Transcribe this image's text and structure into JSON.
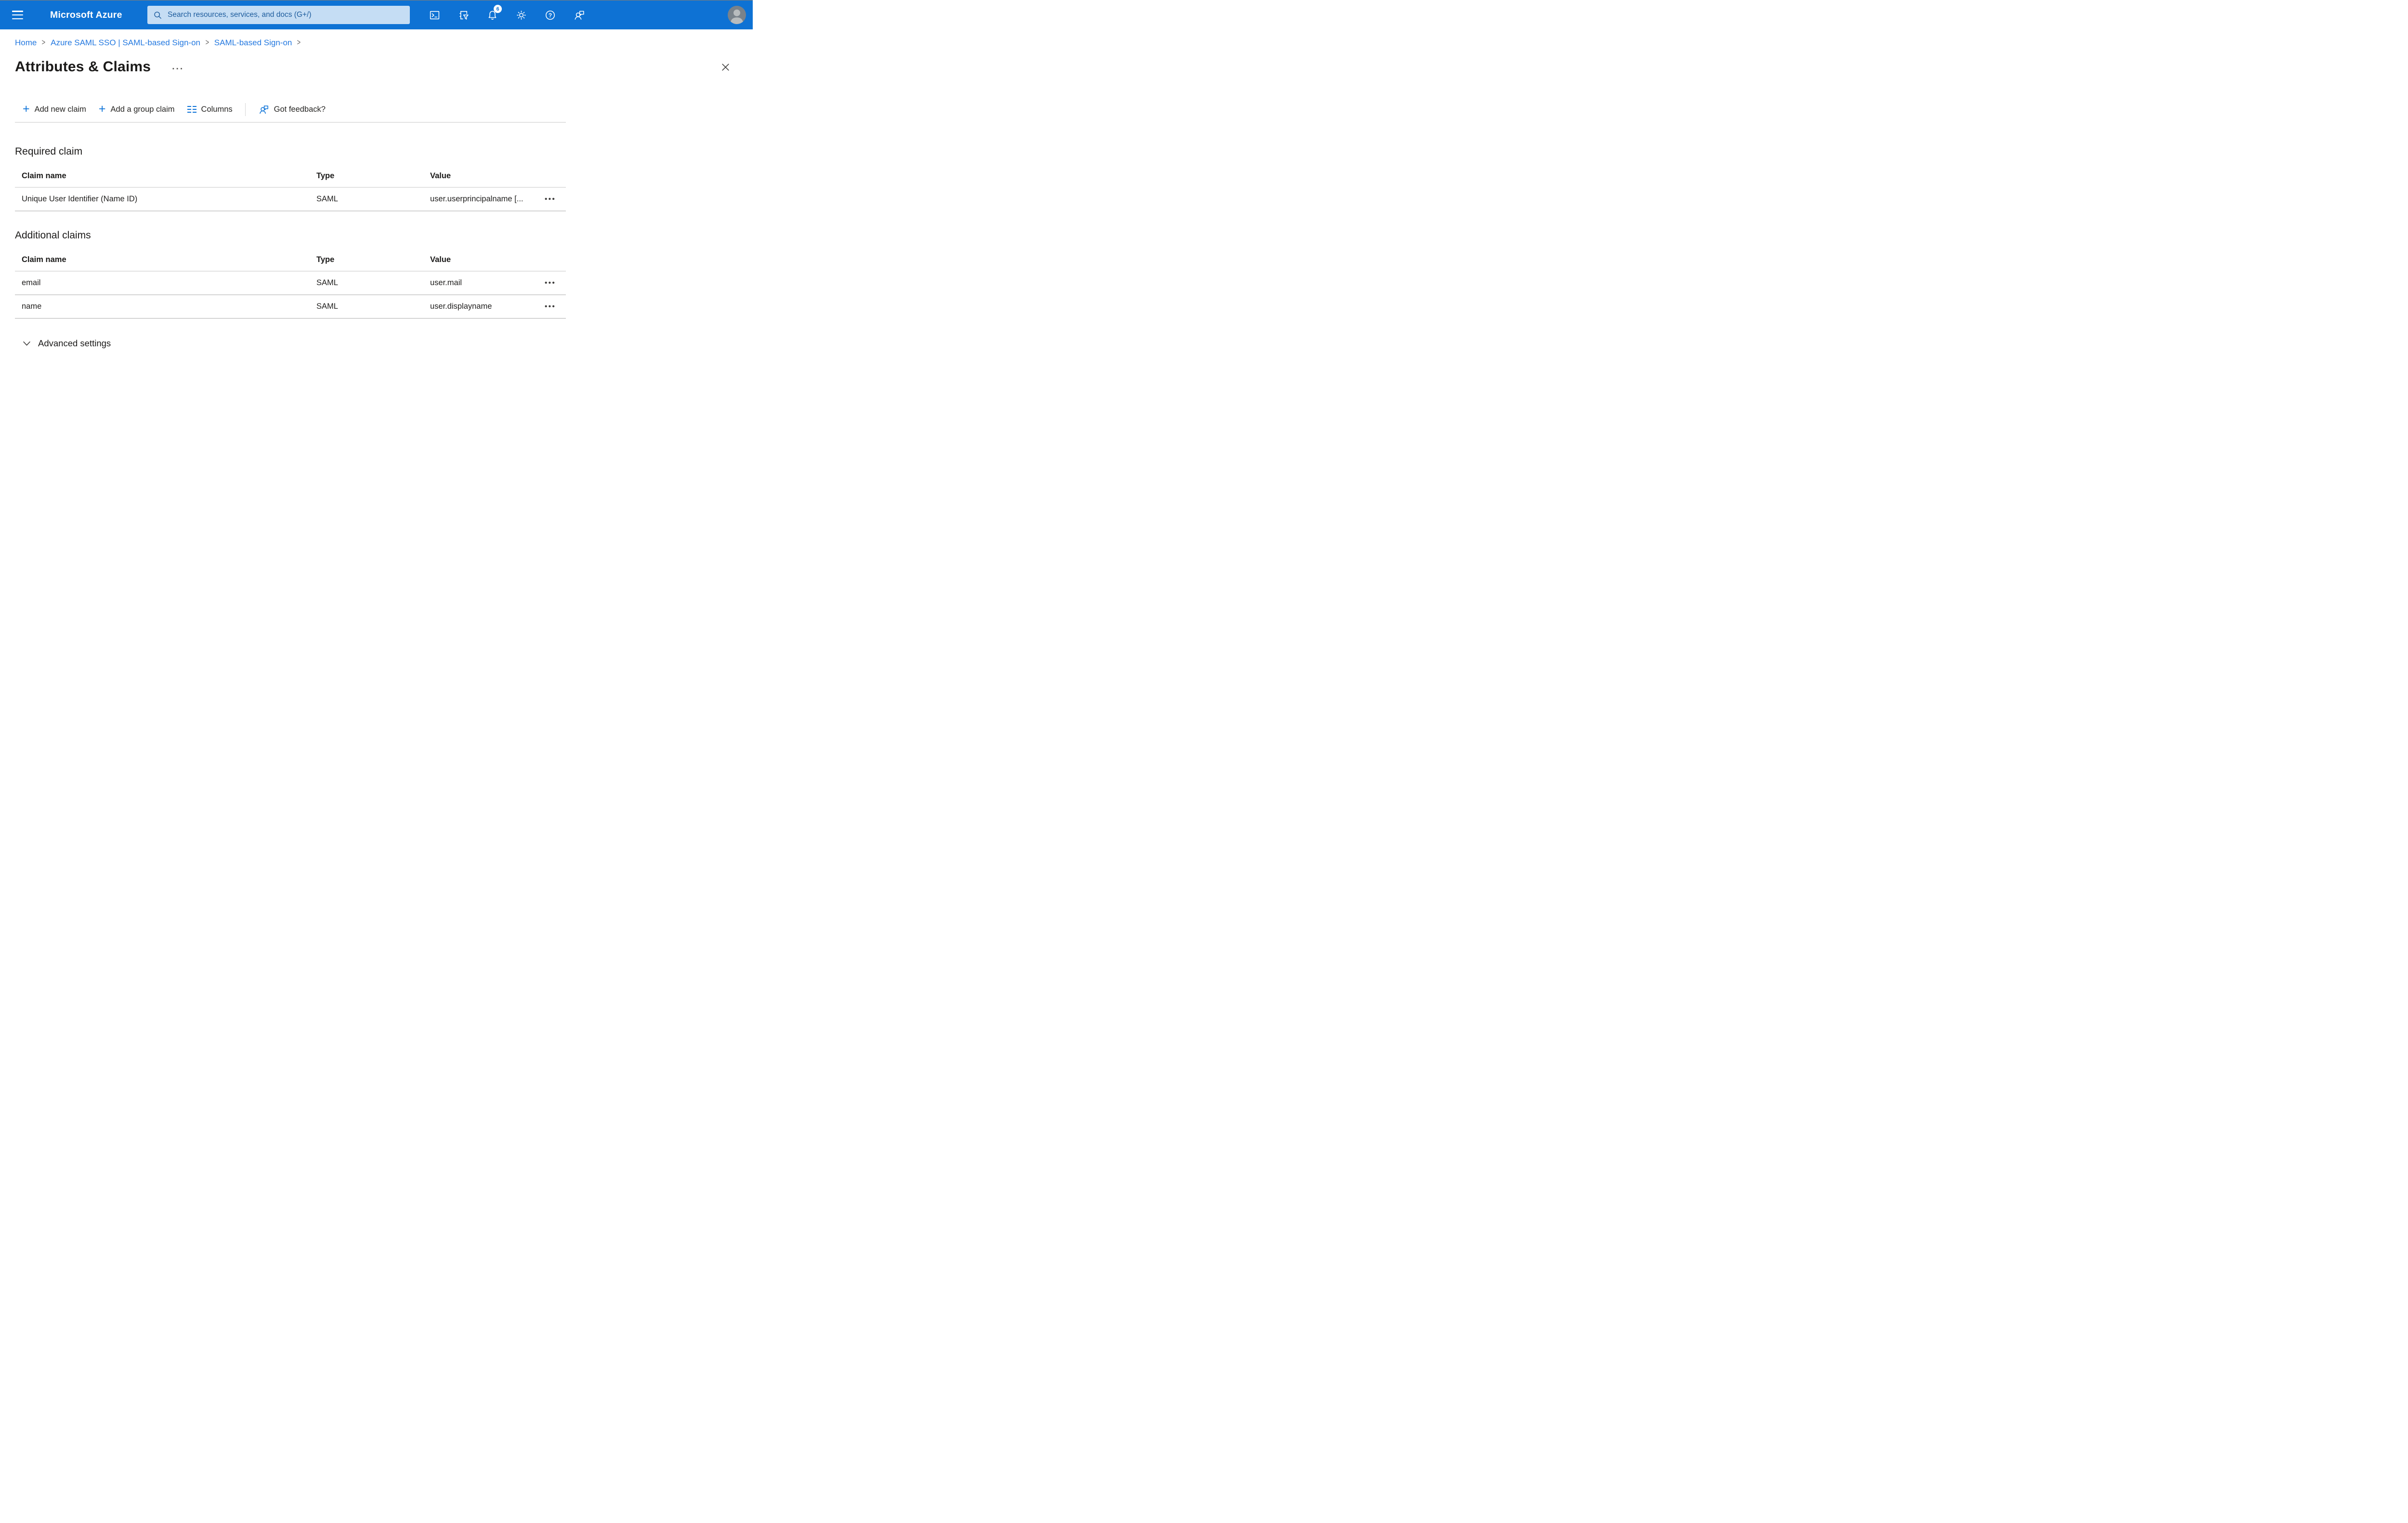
{
  "header": {
    "brand": "Microsoft Azure",
    "search_placeholder": "Search resources, services, and docs (G+/)",
    "notification_count": "6"
  },
  "breadcrumb": {
    "separator": ">",
    "items": [
      "Home",
      "Azure SAML SSO | SAML-based Sign-on",
      "SAML-based Sign-on"
    ]
  },
  "page": {
    "title": "Attributes & Claims"
  },
  "toolbar": {
    "add_new_claim": "Add new claim",
    "add_group_claim": "Add a group claim",
    "columns": "Columns",
    "got_feedback": "Got feedback?"
  },
  "sections": {
    "required": {
      "heading": "Required claim",
      "columns": {
        "claim": "Claim name",
        "type": "Type",
        "value": "Value"
      },
      "rows": [
        {
          "claim": "Unique User Identifier (Name ID)",
          "type": "SAML",
          "value": "user.userprincipalname [..."
        }
      ]
    },
    "additional": {
      "heading": "Additional claims",
      "columns": {
        "claim": "Claim name",
        "type": "Type",
        "value": "Value"
      },
      "rows": [
        {
          "claim": "email",
          "type": "SAML",
          "value": "user.mail"
        },
        {
          "claim": "name",
          "type": "SAML",
          "value": "user.displayname"
        }
      ]
    }
  },
  "advanced": {
    "label": "Advanced settings"
  },
  "icons": {
    "hamburger": "menu-lines",
    "search": "magnifier",
    "cloud_shell": ">_",
    "directory_filter": "book-funnel",
    "notifications": "bell",
    "settings": "gear",
    "help": "?",
    "feedback": "person-chat",
    "avatar": "person",
    "add": "+",
    "columns": "column-dashes",
    "more": "···",
    "row_menu": "•••",
    "close": "✕",
    "chevron_down": "v"
  },
  "colors": {
    "topbar": "#0e72d4",
    "accent": "#0f74d8",
    "link": "#2479e0",
    "search_bg": "#c5ddf4"
  }
}
